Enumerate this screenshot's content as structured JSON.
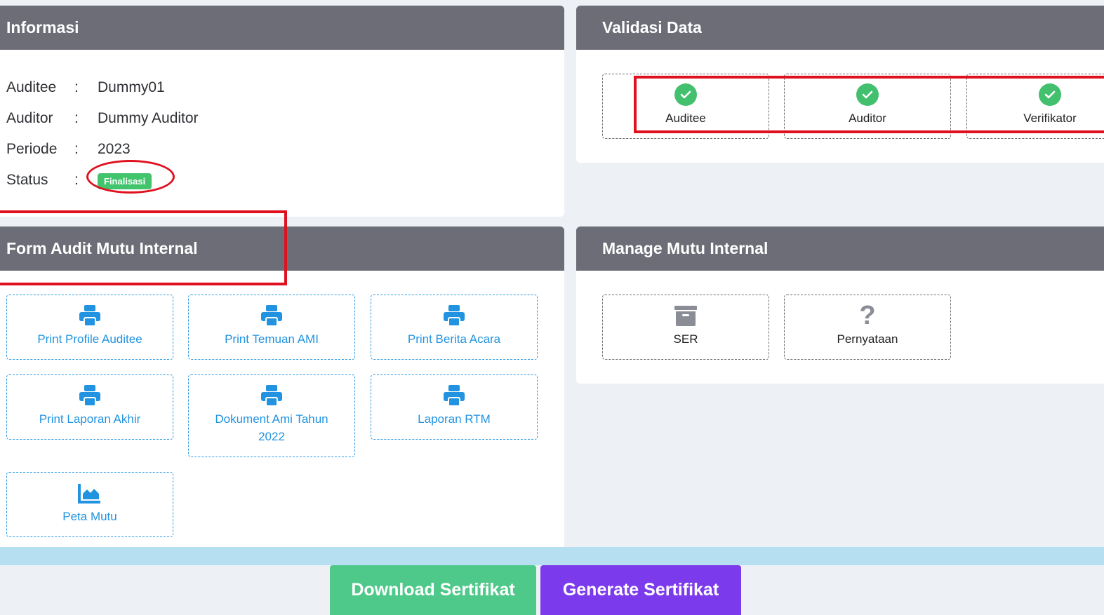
{
  "informasi": {
    "title": "Informasi",
    "rows": [
      {
        "label": "Auditee",
        "value": "Dummy01"
      },
      {
        "label": "Auditor",
        "value": "Dummy Auditor"
      },
      {
        "label": "Periode",
        "value": "2023"
      }
    ],
    "status_label": "Status",
    "colon": ":",
    "status_badge": "Finalisasi"
  },
  "validasi": {
    "title": "Validasi Data",
    "items": [
      {
        "label": "Auditee",
        "icon": "check-circle-icon"
      },
      {
        "label": "Auditor",
        "icon": "check-circle-icon"
      },
      {
        "label": "Verifikator",
        "icon": "check-circle-icon"
      }
    ]
  },
  "form_audit": {
    "title": "Form Audit Mutu Internal",
    "tiles": [
      {
        "label": "Print Profile Auditee",
        "icon": "printer-icon"
      },
      {
        "label": "Print Temuan AMI",
        "icon": "printer-icon"
      },
      {
        "label": "Print Berita Acara",
        "icon": "printer-icon"
      },
      {
        "label": "Print Laporan Akhir",
        "icon": "printer-icon"
      },
      {
        "label": "Dokument Ami Tahun 2022",
        "icon": "printer-icon"
      },
      {
        "label": "Laporan RTM",
        "icon": "printer-icon"
      },
      {
        "label": "Peta Mutu",
        "icon": "area-chart-icon"
      }
    ]
  },
  "manage": {
    "title": "Manage Mutu Internal",
    "tiles": [
      {
        "label": "SER",
        "icon": "archive-box-icon"
      },
      {
        "label": "Pernyataan",
        "icon": "question-mark-icon"
      }
    ]
  },
  "actions": {
    "download_label": "Download Sertifikat",
    "generate_label": "Generate Sertifikat"
  },
  "colors": {
    "header_bg": "#6c6d77",
    "success_green": "#42c46d",
    "link_blue": "#2193e0",
    "annotation_red": "#e0111f",
    "download_btn": "#4ec98a",
    "generate_btn": "#7c3aed"
  }
}
